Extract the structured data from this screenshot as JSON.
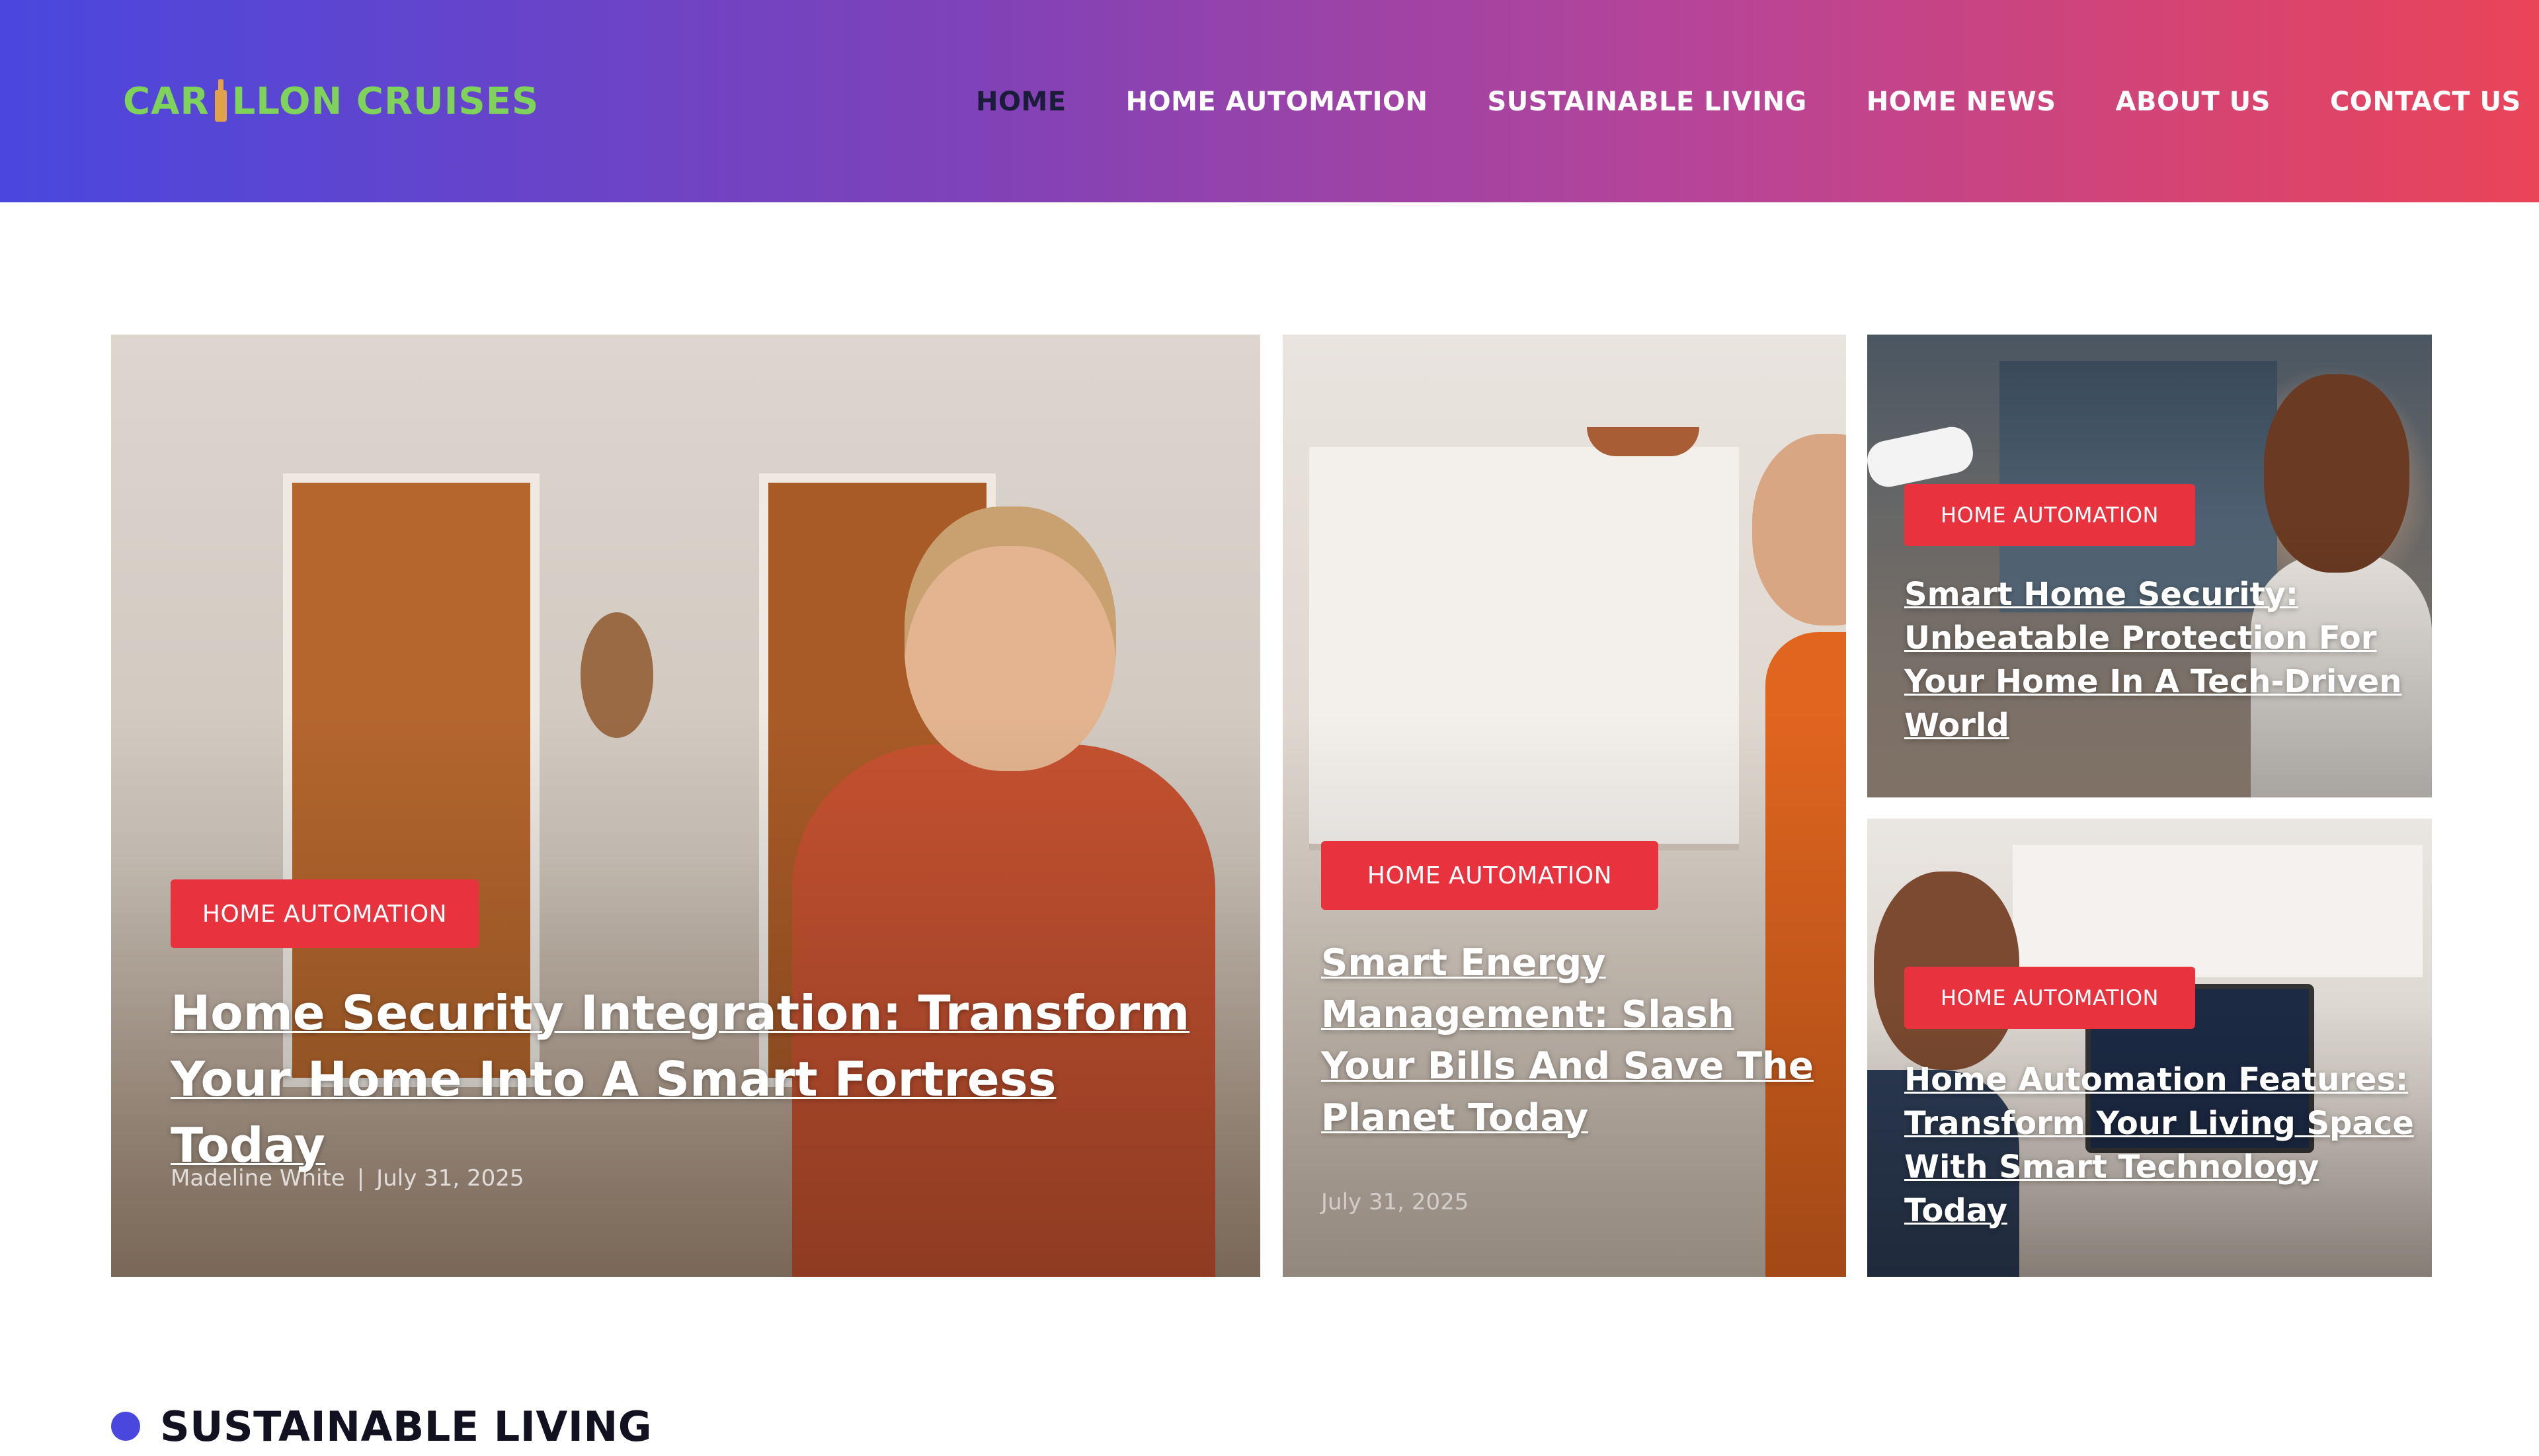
{
  "site": {
    "logo": {
      "before": "CAR",
      "after": "LLON CRUISES"
    }
  },
  "nav": {
    "items": [
      {
        "label": "HOME"
      },
      {
        "label": "HOME AUTOMATION"
      },
      {
        "label": "SUSTAINABLE LIVING"
      },
      {
        "label": "HOME NEWS"
      },
      {
        "label": "ABOUT US"
      },
      {
        "label": "CONTACT US"
      }
    ],
    "active": "HOME"
  },
  "featured": [
    {
      "tag": "HOME AUTOMATION",
      "title": "Home Security Integration: Transform Your Home Into A Smart Fortress Today",
      "author": "Madeline White",
      "separator": "|",
      "date": "July 31, 2025"
    },
    {
      "tag": "HOME AUTOMATION",
      "title": "Smart Energy Management: Slash Your Bills And Save The Planet Today",
      "date": "July 31, 2025"
    },
    {
      "tag": "HOME AUTOMATION",
      "title": "Smart Home Security: Unbeatable Protection For Your Home In A Tech-Driven World"
    },
    {
      "tag": "HOME AUTOMATION",
      "title": "Home Automation Features: Transform Your Living Space With Smart Technology Today"
    }
  ],
  "section": {
    "heading": "SUSTAINABLE LIVING"
  },
  "colors": {
    "header_gradient": [
      "#4a47de",
      "#7f42b8",
      "#b94496",
      "#ea4458"
    ],
    "logo": "#7fd35a",
    "nav_active": "#1b1b3a",
    "tag_bg": "#e8323e",
    "section_dot": "#4a47de"
  },
  "icons": {
    "logo_glyph": "bottle-icon",
    "section_marker": "dot-icon"
  }
}
